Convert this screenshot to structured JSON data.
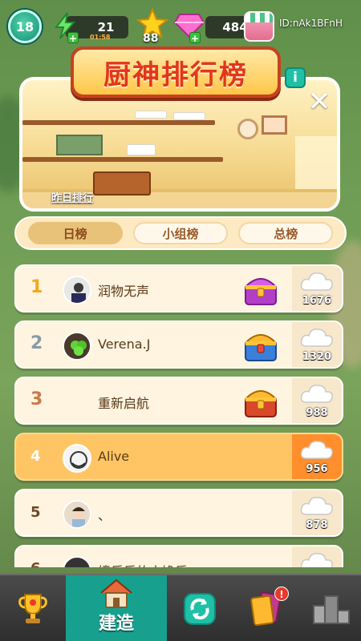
{
  "topbar": {
    "level": "18",
    "energy": "21",
    "energy_timer": "01:58",
    "stars": "88",
    "gems": "484",
    "user_id": "ID:nAk1BFnH"
  },
  "title": "厨神排行榜",
  "info_label": "i",
  "close_label": "✕",
  "yesterday_link": "昨日排行",
  "tabs": [
    {
      "label": "日榜",
      "active": true
    },
    {
      "label": "小组榜",
      "active": false
    },
    {
      "label": "总榜",
      "active": false
    }
  ],
  "rankings": [
    {
      "rank": "1",
      "name": "润物无声",
      "score": "1676",
      "chest": "purple-chest-icon",
      "rank_color": "#f2a71b"
    },
    {
      "rank": "2",
      "name": "Verena.J",
      "score": "1320",
      "chest": "blue-chest-icon",
      "rank_color": "#8a99a8"
    },
    {
      "rank": "3",
      "name": "重新启航",
      "score": "988",
      "chest": "red-chest-icon",
      "rank_color": "#c97a4a"
    },
    {
      "rank": "4",
      "name": "Alive",
      "score": "956",
      "chest": "",
      "rank_color": "#ffffff"
    },
    {
      "rank": "5",
      "name": "、",
      "score": "878",
      "chest": "",
      "rank_color": "#6a4a2a"
    },
    {
      "rank": "6",
      "name": "樟乐乐的小馋乐一",
      "score": "",
      "chest": "",
      "rank_color": "#6a4a2a"
    }
  ],
  "bottom_nav": {
    "build_label": "建造",
    "cards_badge": "!"
  },
  "colors": {
    "accent": "#17a08d",
    "highlight_row": "#ffc564",
    "title_red": "#e2361e"
  }
}
